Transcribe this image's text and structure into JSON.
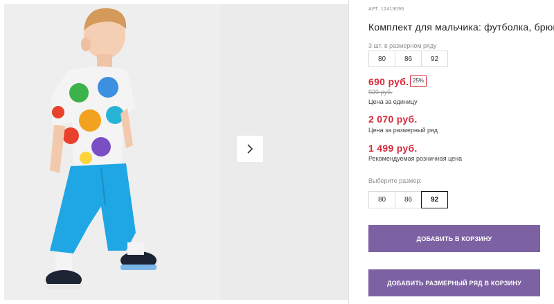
{
  "product": {
    "article": "АРТ. 12419096",
    "title": "Комплект для мальчика: футболка, брюки",
    "pack_label": "3 шт. в размерном ряду",
    "pack_sizes": [
      "80",
      "86",
      "92"
    ]
  },
  "prices": {
    "unit_price": "690 руб.",
    "discount": "25%",
    "old_price": "920 руб.",
    "unit_caption": "Цена за единицу",
    "pack_price": "2 070 руб.",
    "pack_caption": "Цена за размерный ряд",
    "retail_price": "1 499 руб.",
    "retail_caption": "Рекомендуемая розничная цена",
    "accent_color": "#d52a3a"
  },
  "size_picker": {
    "label": "Выберите размер:",
    "options": [
      "80",
      "86",
      "92"
    ],
    "selected": "92"
  },
  "actions": {
    "add_to_cart": "ДОБАВИТЬ В КОРЗИНУ",
    "add_pack_to_cart": "ДОБАВИТЬ РАЗМЕРНЫЙ РЯД В КОРЗИНУ",
    "button_color": "#7d62a3"
  },
  "gallery": {
    "main_image": "boy-in-monster-tshirt-and-blue-pants-photo",
    "next_icon": "chevron-right-icon"
  }
}
